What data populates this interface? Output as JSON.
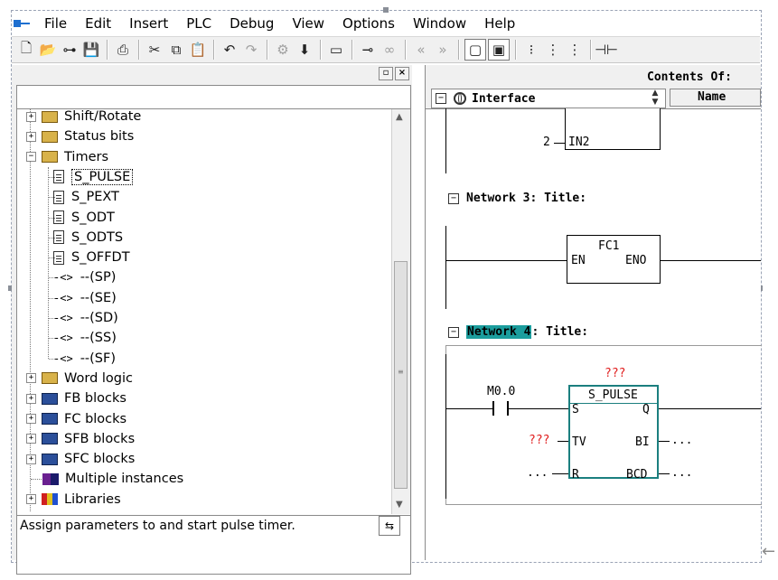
{
  "menu": [
    "File",
    "Edit",
    "Insert",
    "PLC",
    "Debug",
    "View",
    "Options",
    "Window",
    "Help"
  ],
  "toolbar_icons": [
    {
      "name": "new-icon",
      "glyph": "🗋"
    },
    {
      "name": "open-icon",
      "glyph": "📂"
    },
    {
      "name": "accessible-nodes-icon",
      "glyph": "⊶"
    },
    {
      "name": "save-icon",
      "glyph": "💾"
    },
    {
      "name": "print-icon",
      "glyph": "⎙"
    },
    {
      "name": "cut-icon",
      "glyph": "✂"
    },
    {
      "name": "copy-icon",
      "glyph": "⧉"
    },
    {
      "name": "paste-icon",
      "glyph": "📋"
    },
    {
      "name": "undo-icon",
      "glyph": "↶"
    },
    {
      "name": "redo-icon",
      "glyph": "↷"
    },
    {
      "name": "compile-icon",
      "glyph": "⚙"
    },
    {
      "name": "download-icon",
      "glyph": "⬇"
    },
    {
      "name": "monitor-icon",
      "glyph": "▭"
    },
    {
      "name": "online-icon",
      "glyph": "⊸"
    },
    {
      "name": "glasses-icon",
      "glyph": "∞"
    },
    {
      "name": "prev-icon",
      "glyph": "«"
    },
    {
      "name": "next-icon",
      "glyph": "»"
    },
    {
      "name": "overview-icon",
      "glyph": "▢"
    },
    {
      "name": "details-icon",
      "glyph": "▣"
    },
    {
      "name": "bit-logic-icon",
      "glyph": "⁝"
    },
    {
      "name": "branch-icon",
      "glyph": "⋮"
    },
    {
      "name": "tree-icon",
      "glyph": "⋮"
    },
    {
      "name": "contact-icon",
      "glyph": "⊣⊢"
    }
  ],
  "tree": {
    "items": [
      {
        "label": "Shift/Rotate",
        "kind": "folder",
        "pm": "+"
      },
      {
        "label": "Status bits",
        "kind": "folder",
        "pm": "+"
      },
      {
        "label": "Timers",
        "kind": "folder",
        "pm": "-"
      },
      {
        "label": "S_PULSE",
        "kind": "doc"
      },
      {
        "label": "S_PEXT",
        "kind": "doc"
      },
      {
        "label": "S_ODT",
        "kind": "doc"
      },
      {
        "label": "S_ODTS",
        "kind": "doc"
      },
      {
        "label": "S_OFFDT",
        "kind": "doc"
      },
      {
        "label": "--(SP)",
        "kind": "coil"
      },
      {
        "label": "--(SE)",
        "kind": "coil"
      },
      {
        "label": "--(SD)",
        "kind": "coil"
      },
      {
        "label": "--(SS)",
        "kind": "coil"
      },
      {
        "label": "--(SF)",
        "kind": "coil"
      },
      {
        "label": "Word logic",
        "kind": "folder",
        "pm": "+"
      },
      {
        "label": "FB blocks",
        "kind": "blk",
        "pm": "+"
      },
      {
        "label": "FC blocks",
        "kind": "blk",
        "pm": "+"
      },
      {
        "label": "SFB blocks",
        "kind": "blk",
        "pm": "+"
      },
      {
        "label": "SFC blocks",
        "kind": "blk",
        "pm": "+"
      },
      {
        "label": "Multiple instances",
        "kind": "inst"
      },
      {
        "label": "Libraries",
        "kind": "lib",
        "pm": "+"
      }
    ],
    "coil_glyph": "-<>",
    "status_text": "Assign parameters to and start pulse timer.",
    "help_glyph": "⇆"
  },
  "editor": {
    "contents_of": "Contents Of:",
    "interface": "Interface",
    "name_col": "Name",
    "net2": {
      "const": "2",
      "pin": "IN2"
    },
    "net3": {
      "net": "Network 3",
      "sep": ": ",
      "title": "Title:",
      "block": "FC1",
      "en": "EN",
      "eno": "ENO"
    },
    "net4": {
      "net": "Network 4",
      "sep": ": ",
      "title": "Title:",
      "block": "S_PULSE",
      "addr": "???",
      "contact": "M0.0",
      "pins_left": [
        "S",
        "TV",
        "R"
      ],
      "pins_right": [
        "Q",
        "BI",
        "BCD"
      ],
      "tv_val": "???",
      "r_val": "...",
      "bi_val": "...",
      "bcd_val": "..."
    },
    "colors": {
      "highlight": "#1b9d9d",
      "box_outline": "#1b7f7f",
      "unset": "#e02020"
    }
  },
  "corner_arrow": "←"
}
